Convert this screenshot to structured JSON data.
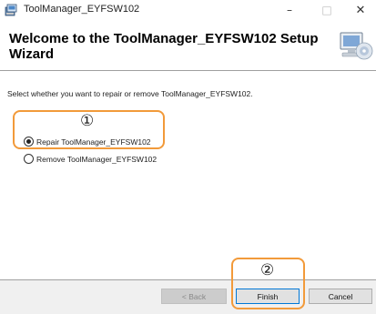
{
  "window": {
    "title": "ToolManager_EYFSW102",
    "minimize_glyph": "–",
    "maximize_glyph": "□",
    "close_glyph": "✕",
    "icon": "installer-icon"
  },
  "header": {
    "title": "Welcome to the ToolManager_EYFSW102 Setup Wizard",
    "art_icon": "computer-cd-icon"
  },
  "body": {
    "instruction": "Select whether you want to repair or remove ToolManager_EYFSW102.",
    "options": [
      {
        "label": "Repair ToolManager_EYFSW102",
        "selected": true
      },
      {
        "label": "Remove ToolManager_EYFSW102",
        "selected": false
      }
    ]
  },
  "annotations": {
    "step1": "①",
    "step2": "②",
    "color": "#f29a3a"
  },
  "footer": {
    "back_label": "< Back",
    "finish_label": "Finish",
    "cancel_label": "Cancel"
  }
}
